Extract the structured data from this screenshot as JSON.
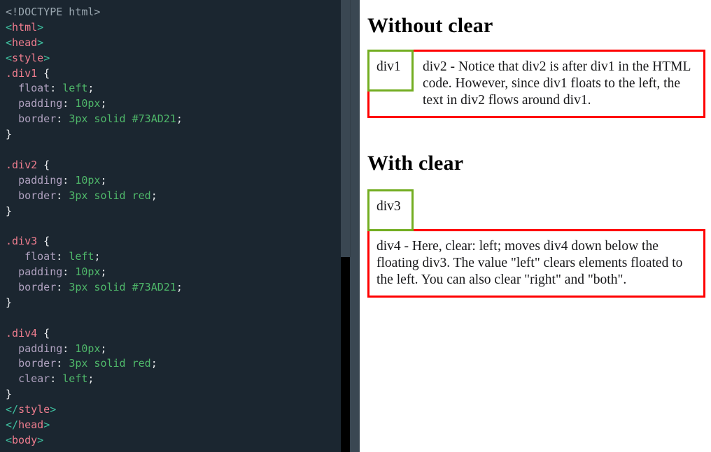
{
  "window": {
    "title": "CSS clear property demo - code editor with live preview",
    "layout": "split-pane: code editor left, rendered preview right"
  },
  "editor": {
    "background_color": "#1b2630",
    "language": "html",
    "code_lines": [
      {
        "tokens": [
          {
            "t": "<!DOCTYPE html>",
            "c": "t-doctype"
          }
        ]
      },
      {
        "tokens": [
          {
            "t": "<",
            "c": "t-punct"
          },
          {
            "t": "html",
            "c": "t-tag"
          },
          {
            "t": ">",
            "c": "t-punct"
          }
        ]
      },
      {
        "tokens": [
          {
            "t": "<",
            "c": "t-punct"
          },
          {
            "t": "head",
            "c": "t-tag"
          },
          {
            "t": ">",
            "c": "t-punct"
          }
        ]
      },
      {
        "tokens": [
          {
            "t": "<",
            "c": "t-punct"
          },
          {
            "t": "style",
            "c": "t-tag"
          },
          {
            "t": ">",
            "c": "t-punct"
          }
        ]
      },
      {
        "tokens": [
          {
            "t": ".div1",
            "c": "t-sel"
          },
          {
            "t": " {",
            "c": "t-brace"
          }
        ]
      },
      {
        "tokens": [
          {
            "t": "  ",
            "c": "t-brace"
          },
          {
            "t": "float",
            "c": "t-prop"
          },
          {
            "t": ": ",
            "c": "t-brace"
          },
          {
            "t": "left",
            "c": "t-val"
          },
          {
            "t": ";",
            "c": "t-brace"
          }
        ]
      },
      {
        "tokens": [
          {
            "t": "  ",
            "c": "t-brace"
          },
          {
            "t": "padding",
            "c": "t-prop"
          },
          {
            "t": ": ",
            "c": "t-brace"
          },
          {
            "t": "10px",
            "c": "t-val"
          },
          {
            "t": ";",
            "c": "t-brace"
          }
        ]
      },
      {
        "tokens": [
          {
            "t": "  ",
            "c": "t-brace"
          },
          {
            "t": "border",
            "c": "t-prop"
          },
          {
            "t": ": ",
            "c": "t-brace"
          },
          {
            "t": "3px solid #73AD21",
            "c": "t-val"
          },
          {
            "t": ";",
            "c": "t-brace"
          }
        ]
      },
      {
        "tokens": [
          {
            "t": "}",
            "c": "t-brace"
          }
        ]
      },
      {
        "tokens": [
          {
            "t": "",
            "c": "t-brace"
          }
        ]
      },
      {
        "tokens": [
          {
            "t": ".div2",
            "c": "t-sel"
          },
          {
            "t": " {",
            "c": "t-brace"
          }
        ]
      },
      {
        "tokens": [
          {
            "t": "  ",
            "c": "t-brace"
          },
          {
            "t": "padding",
            "c": "t-prop"
          },
          {
            "t": ": ",
            "c": "t-brace"
          },
          {
            "t": "10px",
            "c": "t-val"
          },
          {
            "t": ";",
            "c": "t-brace"
          }
        ]
      },
      {
        "tokens": [
          {
            "t": "  ",
            "c": "t-brace"
          },
          {
            "t": "border",
            "c": "t-prop"
          },
          {
            "t": ": ",
            "c": "t-brace"
          },
          {
            "t": "3px solid red",
            "c": "t-val"
          },
          {
            "t": ";",
            "c": "t-brace"
          }
        ]
      },
      {
        "tokens": [
          {
            "t": "}",
            "c": "t-brace"
          }
        ]
      },
      {
        "tokens": [
          {
            "t": "",
            "c": "t-brace"
          }
        ]
      },
      {
        "tokens": [
          {
            "t": ".div3",
            "c": "t-sel"
          },
          {
            "t": " {",
            "c": "t-brace"
          }
        ]
      },
      {
        "tokens": [
          {
            "t": "   ",
            "c": "t-brace"
          },
          {
            "t": "float",
            "c": "t-prop"
          },
          {
            "t": ": ",
            "c": "t-brace"
          },
          {
            "t": "left",
            "c": "t-val"
          },
          {
            "t": ";",
            "c": "t-brace"
          }
        ]
      },
      {
        "tokens": [
          {
            "t": "  ",
            "c": "t-brace"
          },
          {
            "t": "padding",
            "c": "t-prop"
          },
          {
            "t": ": ",
            "c": "t-brace"
          },
          {
            "t": "10px",
            "c": "t-val"
          },
          {
            "t": ";",
            "c": "t-brace"
          }
        ]
      },
      {
        "tokens": [
          {
            "t": "  ",
            "c": "t-brace"
          },
          {
            "t": "border",
            "c": "t-prop"
          },
          {
            "t": ": ",
            "c": "t-brace"
          },
          {
            "t": "3px solid #73AD21",
            "c": "t-val"
          },
          {
            "t": ";",
            "c": "t-brace"
          }
        ]
      },
      {
        "tokens": [
          {
            "t": "}",
            "c": "t-brace"
          }
        ]
      },
      {
        "tokens": [
          {
            "t": "",
            "c": "t-brace"
          }
        ]
      },
      {
        "tokens": [
          {
            "t": ".div4",
            "c": "t-sel"
          },
          {
            "t": " {",
            "c": "t-brace"
          }
        ]
      },
      {
        "tokens": [
          {
            "t": "  ",
            "c": "t-brace"
          },
          {
            "t": "padding",
            "c": "t-prop"
          },
          {
            "t": ": ",
            "c": "t-brace"
          },
          {
            "t": "10px",
            "c": "t-val"
          },
          {
            "t": ";",
            "c": "t-brace"
          }
        ]
      },
      {
        "tokens": [
          {
            "t": "  ",
            "c": "t-brace"
          },
          {
            "t": "border",
            "c": "t-prop"
          },
          {
            "t": ": ",
            "c": "t-brace"
          },
          {
            "t": "3px solid red",
            "c": "t-val"
          },
          {
            "t": ";",
            "c": "t-brace"
          }
        ]
      },
      {
        "tokens": [
          {
            "t": "  ",
            "c": "t-brace"
          },
          {
            "t": "clear",
            "c": "t-prop"
          },
          {
            "t": ": ",
            "c": "t-brace"
          },
          {
            "t": "left",
            "c": "t-val"
          },
          {
            "t": ";",
            "c": "t-brace"
          }
        ]
      },
      {
        "tokens": [
          {
            "t": "}",
            "c": "t-brace"
          }
        ]
      },
      {
        "tokens": [
          {
            "t": "</",
            "c": "t-punct"
          },
          {
            "t": "style",
            "c": "t-tag"
          },
          {
            "t": ">",
            "c": "t-punct"
          }
        ]
      },
      {
        "tokens": [
          {
            "t": "</",
            "c": "t-punct"
          },
          {
            "t": "head",
            "c": "t-tag"
          },
          {
            "t": ">",
            "c": "t-punct"
          }
        ]
      },
      {
        "tokens": [
          {
            "t": "<",
            "c": "t-punct"
          },
          {
            "t": "body",
            "c": "t-tag"
          },
          {
            "t": ">",
            "c": "t-punct"
          }
        ]
      }
    ]
  },
  "scrollbar": {
    "orientation": "vertical",
    "track_color": "#3a4752",
    "thumb_color": "#000000"
  },
  "preview": {
    "background_color": "#ffffff",
    "section_without_clear": {
      "heading": "Without clear",
      "float_box": {
        "label": "div1",
        "border_color": "#73AD21"
      },
      "flow_box": {
        "text": "div2 - Notice that div2 is after div1 in the HTML code. However, since div1 floats to the left, the text in div2 flows around div1.",
        "border_color": "#ff0000"
      }
    },
    "section_with_clear": {
      "heading": "With clear",
      "float_box": {
        "label": "div3",
        "border_color": "#73AD21"
      },
      "cleared_box": {
        "text": "div4 - Here, clear: left; moves div4 down below the floating div3. The value \"left\" clears elements floated to the left. You can also clear \"right\" and \"both\".",
        "border_color": "#ff0000"
      }
    }
  }
}
